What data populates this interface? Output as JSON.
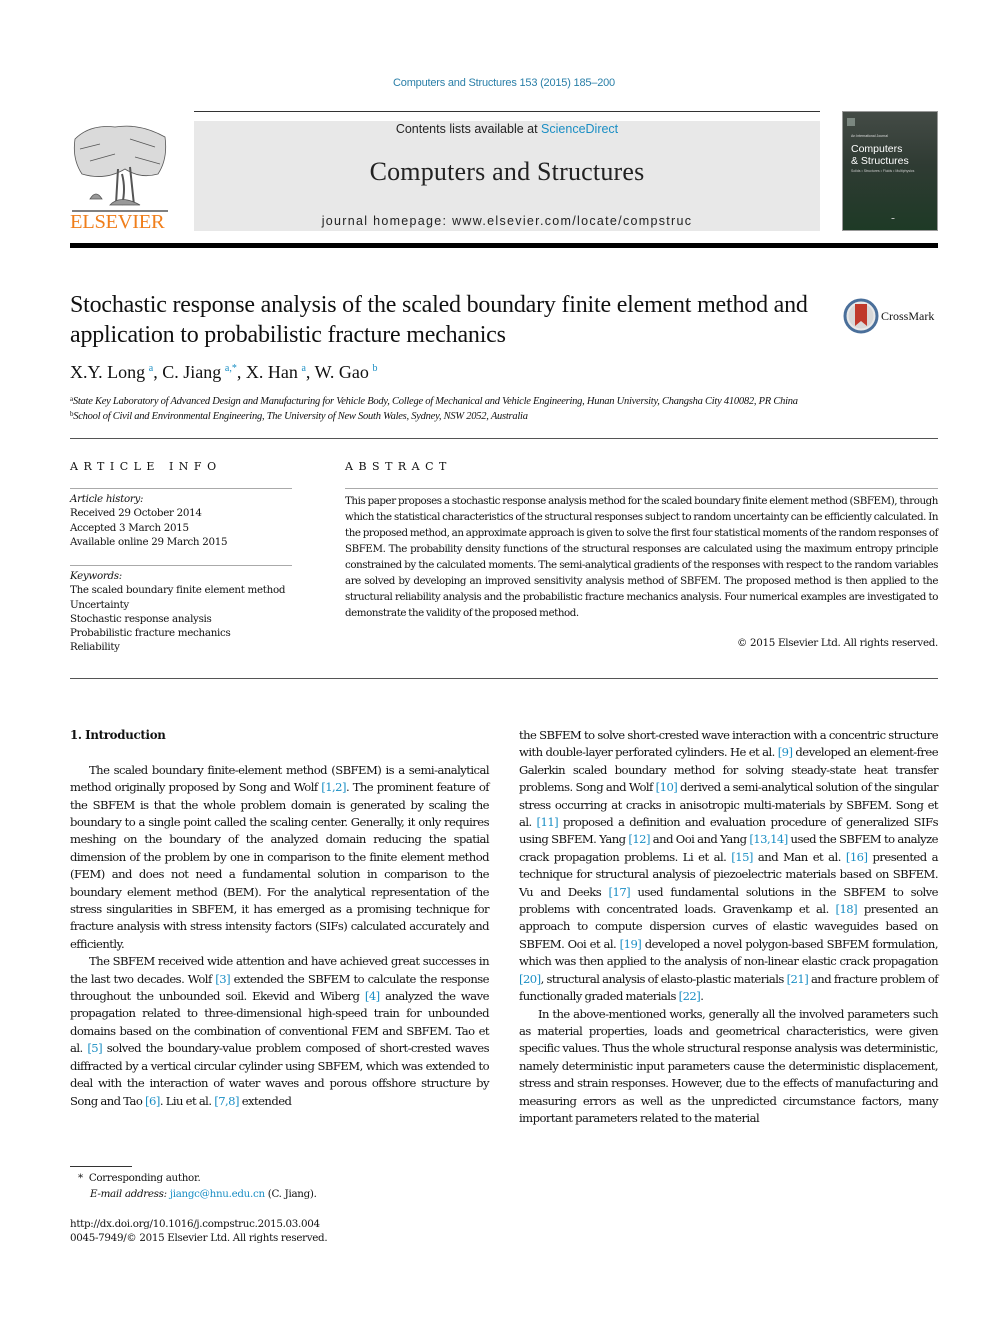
{
  "header": {
    "journal_ref": "Computers and Structures 153 (2015) 185–200",
    "contents_prefix": "Contents lists available at ",
    "contents_link": "ScienceDirect",
    "journal_name": "Computers and Structures",
    "homepage": "journal homepage: www.elsevier.com/locate/compstruc",
    "publisher_logo": "ELSEVIER",
    "cover": {
      "subtitle": "An International Journal",
      "title_line1": "Computers",
      "title_line2": "& Structures",
      "tagline": "Solids • Structures • Fluids • Multiphysics"
    },
    "colors": {
      "link": "#1a8ec4",
      "elsevier_orange": "#f07e1a",
      "masthead_bg": "#e8e8e8"
    }
  },
  "article": {
    "title": "Stochastic response analysis of the scaled boundary finite element method and application to probabilistic fracture mechanics",
    "crossmark_label": "CrossMark",
    "authors": [
      {
        "name": "X.Y. Long",
        "sup": "a",
        "sep": ", "
      },
      {
        "name": "C. Jiang",
        "sup": "a,*",
        "sep": ", "
      },
      {
        "name": "X. Han",
        "sup": "a",
        "sep": ", "
      },
      {
        "name": "W. Gao",
        "sup": "b",
        "sep": ""
      }
    ],
    "affiliations": [
      {
        "mark": "a",
        "text": "State Key Laboratory of Advanced Design and Manufacturing for Vehicle Body, College of Mechanical and Vehicle Engineering, Hunan University, Changsha City 410082, PR China"
      },
      {
        "mark": "b",
        "text": "School of Civil and Environmental Engineering, The University of New South Wales, Sydney, NSW 2052, Australia"
      }
    ]
  },
  "article_info": {
    "heading": "ARTICLE INFO",
    "history_label": "Article history:",
    "history": [
      "Received 29 October 2014",
      "Accepted 3 March 2015",
      "Available online 29 March 2015"
    ],
    "keywords_label": "Keywords:",
    "keywords": [
      "The scaled boundary finite element method",
      "Uncertainty",
      "Stochastic response analysis",
      "Probabilistic fracture mechanics",
      "Reliability"
    ]
  },
  "abstract": {
    "heading": "ABSTRACT",
    "text": "This paper proposes a stochastic response analysis method for the scaled boundary finite element method (SBFEM), through which the statistical characteristics of the structural responses subject to random uncertainty can be efficiently calculated. In the proposed method, an approximate approach is given to solve the first four statistical moments of the random responses of SBFEM. The probability density functions of the structural responses are calculated using the maximum entropy principle constrained by the calculated moments. The semi-analytical gradients of the responses with respect to the random variables are solved by developing an improved sensitivity analysis method of SBFEM. The proposed method is then applied to the structural reliability analysis and the probabilistic fracture mechanics analysis. Four numerical examples are investigated to demonstrate the validity of the proposed method.",
    "copyright": "© 2015 Elsevier Ltd. All rights reserved."
  },
  "body": {
    "section_title": "1. Introduction",
    "left_paragraphs": [
      [
        {
          "t": "The scaled boundary finite-element method (SBFEM) is a semi-analytical method originally proposed by Song and Wolf "
        },
        {
          "ref": "[1,2]"
        },
        {
          "t": ". The prominent feature of the SBFEM is that the whole problem domain is generated by scaling the boundary to a single point called the scaling center. Generally, it only requires meshing on the boundary of the analyzed domain reducing the spatial dimension of the problem by one in comparison to the finite element method (FEM) and does not need a fundamental solution in comparison to the boundary element method (BEM). For the analytical representation of the stress singularities in SBFEM, it has emerged as a promising technique for fracture analysis with stress intensity factors (SIFs) calculated accurately and efficiently."
        }
      ],
      [
        {
          "t": "The SBFEM received wide attention and have achieved great successes in the last two decades. Wolf "
        },
        {
          "ref": "[3]"
        },
        {
          "t": " extended the SBFEM to calculate the response throughout the unbounded soil. Ekevid and Wiberg "
        },
        {
          "ref": "[4]"
        },
        {
          "t": " analyzed the wave propagation related to three-dimensional high-speed train for unbounded domains based on the combination of conventional FEM and SBFEM. Tao et al. "
        },
        {
          "ref": "[5]"
        },
        {
          "t": " solved the boundary-value problem composed of short-crested waves diffracted by a vertical circular cylinder using SBFEM, which was extended to deal with the interaction of water waves and porous offshore structure by Song and Tao "
        },
        {
          "ref": "[6]"
        },
        {
          "t": ". Liu et al. "
        },
        {
          "ref": "[7,8]"
        },
        {
          "t": " extended"
        }
      ]
    ],
    "right_paragraphs": [
      [
        {
          "t": "the SBFEM to solve short-crested wave interaction with a concentric structure with double-layer perforated cylinders. He et al. "
        },
        {
          "ref": "[9]"
        },
        {
          "t": " developed an element-free Galerkin scaled boundary method for solving steady-state heat transfer problems. Song and Wolf "
        },
        {
          "ref": "[10]"
        },
        {
          "t": " derived a semi-analytical solution of the singular stress occurring at cracks in anisotropic multi-materials by SBFEM. Song et al. "
        },
        {
          "ref": "[11]"
        },
        {
          "t": " proposed a definition and evaluation procedure of generalized SIFs using SBFEM. Yang "
        },
        {
          "ref": "[12]"
        },
        {
          "t": " and Ooi and Yang "
        },
        {
          "ref": "[13,14]"
        },
        {
          "t": " used the SBFEM to analyze crack propagation problems. Li et al. "
        },
        {
          "ref": "[15]"
        },
        {
          "t": " and Man et al. "
        },
        {
          "ref": "[16]"
        },
        {
          "t": " presented a technique for structural analysis of piezoelectric materials based on SBFEM. Vu and Deeks "
        },
        {
          "ref": "[17]"
        },
        {
          "t": " used fundamental solutions in the SBFEM to solve problems with concentrated loads. Gravenkamp et al. "
        },
        {
          "ref": "[18]"
        },
        {
          "t": " presented an approach to compute dispersion curves of elastic waveguides based on SBFEM. Ooi et al. "
        },
        {
          "ref": "[19]"
        },
        {
          "t": " developed a novel polygon-based SBFEM formulation, which was then applied to the analysis of non-linear elastic crack propagation "
        },
        {
          "ref": "[20]"
        },
        {
          "t": ", structural analysis of elasto-plastic materials "
        },
        {
          "ref": "[21]"
        },
        {
          "t": " and fracture problem of functionally graded materials "
        },
        {
          "ref": "[22]"
        },
        {
          "t": "."
        }
      ],
      [
        {
          "t": "In the above-mentioned works, generally all the involved parameters such as material properties, loads and geometrical characteristics, were given specific values. Thus the whole structural response analysis was deterministic, namely deterministic input parameters cause the deterministic displacement, stress and strain responses. However, due to the effects of manufacturing and measuring errors as well as the unpredicted circumstance factors, many important parameters related to the material"
        }
      ]
    ]
  },
  "footnotes": {
    "corresponding_mark": "*",
    "corresponding_text": "Corresponding author.",
    "email_label": "E-mail address:",
    "email": "jiangc@hnu.edu.cn",
    "email_suffix": " (C. Jiang).",
    "doi": "http://dx.doi.org/10.1016/j.compstruc.2015.03.004",
    "issn": "0045-7949/© 2015 Elsevier Ltd. All rights reserved."
  }
}
